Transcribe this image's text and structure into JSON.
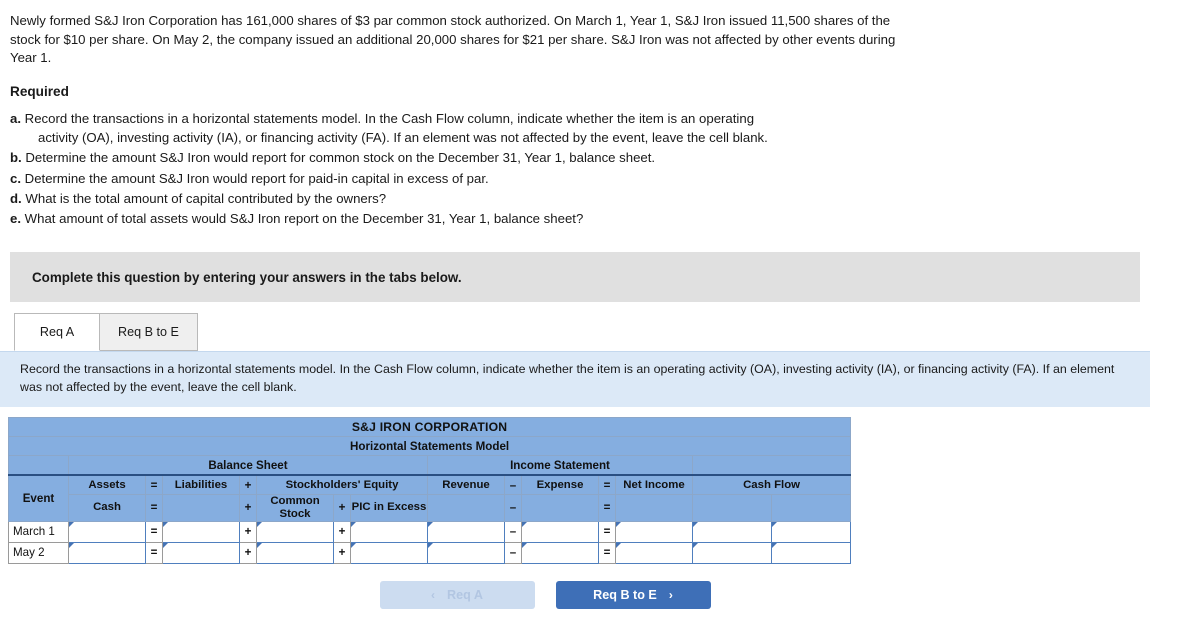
{
  "problem": {
    "text": "Newly formed S&J Iron Corporation has 161,000 shares of $3 par common stock authorized. On March 1, Year 1, S&J Iron issued 11,500 shares of the stock for $10 per share. On May 2, the company issued an additional 20,000 shares for $21 per share. S&J Iron was not affected by other events during Year 1."
  },
  "required": {
    "heading": "Required",
    "items": [
      {
        "marker": "a.",
        "text": "Record the transactions in a horizontal statements model. In the Cash Flow column, indicate whether the item is an operating",
        "continuation": "activity (OA), investing activity (IA), or financing activity (FA). If an element was not affected by the event, leave the cell blank."
      },
      {
        "marker": "b.",
        "text": "Determine the amount S&J Iron would report for common stock on the December 31, Year 1, balance sheet.",
        "continuation": ""
      },
      {
        "marker": "c.",
        "text": "Determine the amount S&J Iron would report for paid-in capital in excess of par.",
        "continuation": ""
      },
      {
        "marker": "d.",
        "text": "What is the total amount of capital contributed by the owners?",
        "continuation": ""
      },
      {
        "marker": "e.",
        "text": "What amount of total assets would S&J Iron report on the December 31, Year 1, balance sheet?",
        "continuation": ""
      }
    ]
  },
  "gray_banner": {
    "text": "Complete this question by entering your answers in the tabs below."
  },
  "tabs": [
    {
      "label": "Req A",
      "active": true
    },
    {
      "label": "Req B to E",
      "active": false
    }
  ],
  "instruction_box": {
    "text": "Record the transactions in a horizontal statements model. In the Cash Flow column, indicate whether the item is an operating activity (OA), investing activity (IA), or financing activity (FA). If an element was not affected by the event, leave the cell blank."
  },
  "table": {
    "title": "S&J IRON CORPORATION",
    "subtitle": "Horizontal Statements Model",
    "groups": [
      {
        "label": "Balance Sheet"
      },
      {
        "label": "Income Statement"
      }
    ],
    "event_header": "Event",
    "columns_top": [
      {
        "label": "Assets"
      },
      {
        "label": "Liabilities"
      },
      {
        "label": "Stockholders' Equity"
      },
      {
        "label": "Revenue"
      },
      {
        "label": "Expense"
      },
      {
        "label": "Net Income"
      },
      {
        "label": "Cash Flow"
      }
    ],
    "columns_sub": [
      {
        "label": "Cash"
      },
      {
        "label": ""
      },
      {
        "label": "Common Stock"
      },
      {
        "label": "PIC in Excess"
      },
      {
        "label": ""
      },
      {
        "label": ""
      },
      {
        "label": ""
      },
      {
        "label": ""
      }
    ],
    "operators": {
      "equals": "=",
      "plus": "+",
      "minus": "–"
    },
    "rows": [
      {
        "event": "March 1",
        "cash": "",
        "liabilities": "",
        "common_stock": "",
        "pic_in_excess": "",
        "revenue": "",
        "expense": "",
        "net_income": "",
        "cash_flow_amount": "",
        "cash_flow_activity": ""
      },
      {
        "event": "May 2",
        "cash": "",
        "liabilities": "",
        "common_stock": "",
        "pic_in_excess": "",
        "revenue": "",
        "expense": "",
        "net_income": "",
        "cash_flow_amount": "",
        "cash_flow_activity": ""
      }
    ]
  },
  "nav": {
    "prev_label": "Req A",
    "prev_chevron": "‹",
    "next_label": "Req B to E",
    "next_chevron": "›"
  },
  "colors": {
    "header_blue": "#85aee0",
    "instruction_blue": "#dce9f7",
    "gray_banner": "#e0e0e0",
    "button_blue": "#3e6fb7",
    "button_disabled": "#ccdcf0",
    "cell_border_blue": "#4f7fbe",
    "corner_marker": "#4573b4"
  }
}
